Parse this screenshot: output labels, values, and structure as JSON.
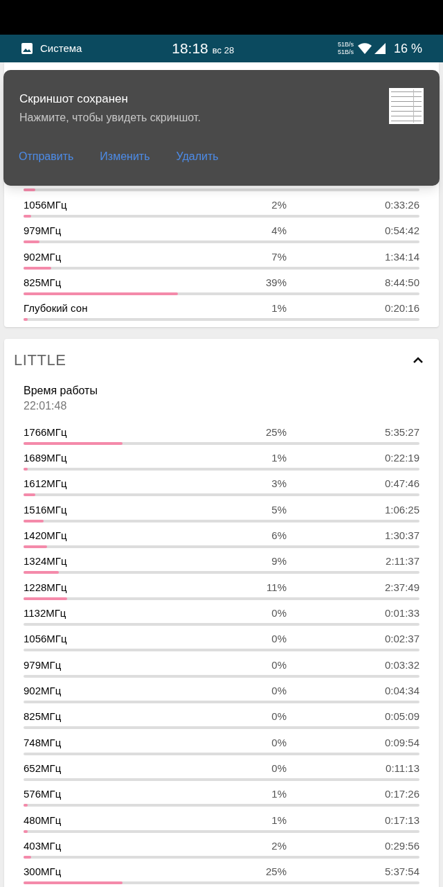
{
  "status_bar": {
    "app": "Система",
    "time": "18:18",
    "date": "вс 28",
    "upload": "51B/s",
    "download": "51B/s",
    "battery": "16 %"
  },
  "top_card": {
    "covered_row_bar": {
      "level": 0.03
    },
    "rows": [
      {
        "label": "1056МГц",
        "percent": "2%",
        "time": "0:33:26",
        "level": 0.02
      },
      {
        "label": "979МГц",
        "percent": "4%",
        "time": "0:54:42",
        "level": 0.04
      },
      {
        "label": "902МГц",
        "percent": "7%",
        "time": "1:34:14",
        "level": 0.07
      },
      {
        "label": "825МГц",
        "percent": "39%",
        "time": "8:44:50",
        "level": 0.39
      },
      {
        "label": "Глубокий сон",
        "percent": "1%",
        "time": "0:20:16",
        "level": 0.01
      }
    ]
  },
  "little_card": {
    "title": "LITTLE",
    "expanded": true,
    "uptime_label": "Время работы",
    "uptime": "22:01:48",
    "rows": [
      {
        "label": "1766МГц",
        "percent": "25%",
        "time": "5:35:27",
        "level": 0.25
      },
      {
        "label": "1689МГц",
        "percent": "1%",
        "time": "0:22:19",
        "level": 0.01
      },
      {
        "label": "1612МГц",
        "percent": "3%",
        "time": "0:47:46",
        "level": 0.03
      },
      {
        "label": "1516МГц",
        "percent": "5%",
        "time": "1:06:25",
        "level": 0.05
      },
      {
        "label": "1420МГц",
        "percent": "6%",
        "time": "1:30:37",
        "level": 0.06
      },
      {
        "label": "1324МГц",
        "percent": "9%",
        "time": "2:11:37",
        "level": 0.09
      },
      {
        "label": "1228МГц",
        "percent": "11%",
        "time": "2:37:49",
        "level": 0.11
      },
      {
        "label": "1132МГц",
        "percent": "0%",
        "time": "0:01:33"
      },
      {
        "label": "1056МГц",
        "percent": "0%",
        "time": "0:02:37"
      },
      {
        "label": "979МГц",
        "percent": "0%",
        "time": "0:03:32"
      },
      {
        "label": "902МГц",
        "percent": "0%",
        "time": "0:04:34"
      },
      {
        "label": "825МГц",
        "percent": "0%",
        "time": "0:05:09"
      },
      {
        "label": "748МГц",
        "percent": "0%",
        "time": "0:09:54"
      },
      {
        "label": "652МГц",
        "percent": "0%",
        "time": "0:11:13"
      },
      {
        "label": "576МГц",
        "percent": "1%",
        "time": "0:17:26",
        "level": 0.01
      },
      {
        "label": "480МГц",
        "percent": "1%",
        "time": "0:17:13",
        "level": 0.01
      },
      {
        "label": "403МГц",
        "percent": "2%",
        "time": "0:29:56",
        "level": 0.02
      },
      {
        "label": "300МГц",
        "percent": "25%",
        "time": "5:37:54",
        "level": 0.25
      }
    ]
  },
  "notification": {
    "title": "Скриншот сохранен",
    "text": "Нажмите, чтобы увидеть скриншот.",
    "actions": [
      "Отправить",
      "Изменить",
      "Удалить"
    ]
  }
}
